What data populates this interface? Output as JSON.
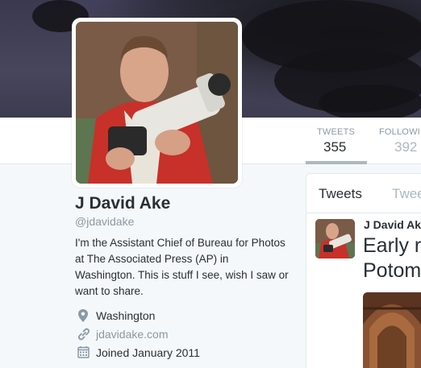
{
  "stats": [
    {
      "label": "TWEETS",
      "value": "355"
    },
    {
      "label": "FOLLOWI",
      "value": "392"
    }
  ],
  "profile": {
    "name": "J David Ake",
    "handle": "@jdavidake",
    "bio": "I'm the Assistant Chief of Bureau for Photos at The Associated Press (AP) in Washington. This is stuff I see, wish I saw or want to share.",
    "location": "Washington",
    "website": "jdavidake.com",
    "joined": "Joined January 2011"
  },
  "timeline": {
    "tabs": [
      {
        "label": "Tweets"
      },
      {
        "label": "Twee"
      }
    ],
    "tweet": {
      "author": "J David Ak",
      "text_line1": "Early r",
      "text_line2": "Potom"
    }
  },
  "colors": {
    "link": "#8899a6",
    "muted": "#8899a6",
    "text": "#292f33",
    "background": "#f5f8fa"
  }
}
